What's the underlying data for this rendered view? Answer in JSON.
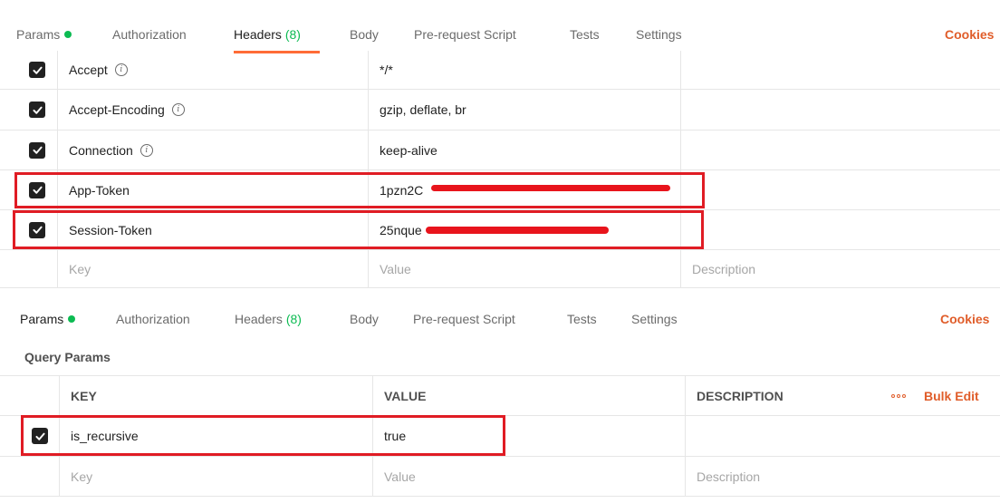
{
  "top_tabs": {
    "params": "Params",
    "authorization": "Authorization",
    "headers_label": "Headers",
    "headers_count": "(8)",
    "body": "Body",
    "prerequest": "Pre-request Script",
    "tests": "Tests",
    "settings": "Settings",
    "cookies": "Cookies",
    "active": "headers"
  },
  "headers_table": {
    "rows": [
      {
        "key": "Accept",
        "value": "*/*",
        "checked": true,
        "info": true
      },
      {
        "key": "Accept-Encoding",
        "value": "gzip, deflate, br",
        "checked": true,
        "info": true
      },
      {
        "key": "Connection",
        "value": "keep-alive",
        "checked": true,
        "info": true
      },
      {
        "key": "App-Token",
        "value": "1pzn2C",
        "checked": true,
        "info": false,
        "redacted": true
      },
      {
        "key": "Session-Token",
        "value": "25nque",
        "checked": true,
        "info": false,
        "redacted": true
      }
    ],
    "placeholder": {
      "key": "Key",
      "value": "Value",
      "description": "Description"
    }
  },
  "bottom_tabs": {
    "params": "Params",
    "authorization": "Authorization",
    "headers_label": "Headers",
    "headers_count": "(8)",
    "body": "Body",
    "prerequest": "Pre-request Script",
    "tests": "Tests",
    "settings": "Settings",
    "cookies": "Cookies"
  },
  "query_params": {
    "title": "Query Params",
    "columns": {
      "key": "KEY",
      "value": "VALUE",
      "description": "DESCRIPTION"
    },
    "bulk_edit": "Bulk Edit",
    "rows": [
      {
        "key": "is_recursive",
        "value": "true",
        "checked": true
      }
    ],
    "placeholder": {
      "key": "Key",
      "value": "Value",
      "description": "Description"
    }
  },
  "colors": {
    "accent": "#ff6c37",
    "green": "#0cbb52",
    "highlight": "#e01c24",
    "link": "#e05d2a"
  },
  "icons": {
    "info": "info-circle-icon",
    "check": "check-icon",
    "more": "more-horizontal-icon"
  }
}
